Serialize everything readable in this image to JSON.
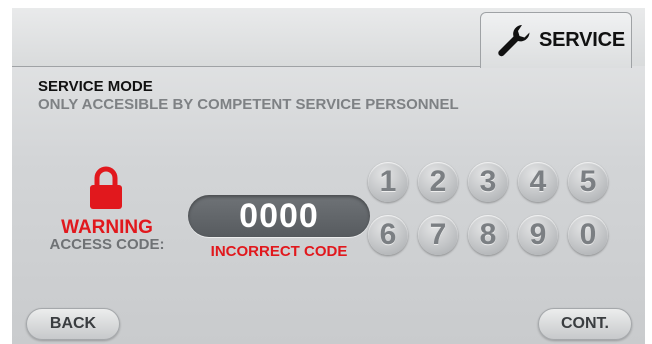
{
  "tab": {
    "label": "SERVICE",
    "icon": "wrench-icon"
  },
  "header": {
    "title": "SERVICE MODE",
    "subtitle": "ONLY ACCESIBLE BY COMPETENT SERVICE PERSONNEL"
  },
  "status": {
    "icon": "lock-icon",
    "warning": "WARNING",
    "access_label": "ACCESS CODE:"
  },
  "code": {
    "value": "0000",
    "error": "INCORRECT CODE"
  },
  "keypad": [
    "1",
    "2",
    "3",
    "4",
    "5",
    "6",
    "7",
    "8",
    "9",
    "0"
  ],
  "buttons": {
    "back": "BACK",
    "cont": "CONT."
  },
  "colors": {
    "alert": "#e1181d",
    "display_bg": "#5f6367",
    "key_text": "#7b7f83"
  }
}
